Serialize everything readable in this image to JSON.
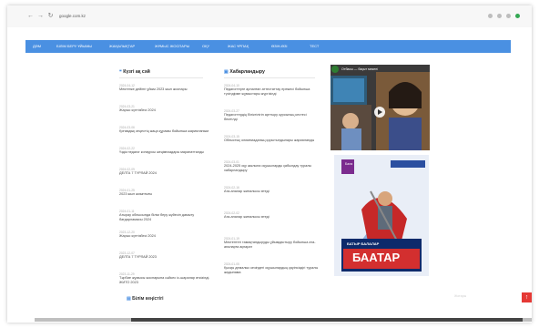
{
  "browser": {
    "url": "google.com.kz"
  },
  "menu": [
    "ДӘМ",
    "БІЛІМ БЕРУ ҰЙЫМЫ",
    "ЖАҢАЛЫҚТАР",
    "ЖҰМЫС ЖОСПАРЫ",
    "ОҚУ",
    "ЖАС ҰРПАҚ",
    "ӨЗІН-ӨЗІ",
    "ТЕСТ"
  ],
  "left_section": {
    "title": "Күзгі ақ сәй",
    "items": [
      {
        "date": "2024-04-12",
        "title": "Мектепке дейінгі ұйым 2023 жыл жоспары"
      },
      {
        "date": "2024-03-21",
        "title": "Жарыс күнтізбесі 2024"
      },
      {
        "date": "2024-03-06",
        "title": "Қоғамдық кеңестің жаңа құрамы бойынша жарияланым"
      },
      {
        "date": "2024-02-22",
        "title": "Үздік педагог конкурсы жеңімпаздары марапатталды"
      },
      {
        "date": "2024-02-09",
        "title": "ДЕЛТА 7 ТУРЛАЙ 2024"
      },
      {
        "date": "2024-01-25",
        "title": "2023 жыл жиынтығы"
      },
      {
        "date": "2024-01-11",
        "title": "Атырау облысында білім беру жүйесін дамыту бағдарламасы 2024"
      },
      {
        "date": "2023-12-20",
        "title": "Жарыс күнтізбесі 2024"
      },
      {
        "date": "2023-12-07",
        "title": "ДЕЛТА 7 ТУРЛАЙ 2023"
      },
      {
        "date": "2023-11-29",
        "title": "Тәрбие жұмысы жоспарына сәйкес іс-шаралар өткізілді. ЖИТО 2023"
      }
    ]
  },
  "middle_section": {
    "title": "Хабарландыру",
    "items": [
      {
        "date": "2024-04-10",
        "title": "Педагогтерге арналған аттестаттау ережесі бойынша түсіндірме жұмыстары жүргізілді"
      },
      {
        "date": "2024-03-27",
        "title": "Педагогтердің біліктілігін арттыру курсының кестесі бекітілді"
      },
      {
        "date": "2024-03-15",
        "title": "Облыстық олимпиаданың қорытындылары жарияланды"
      },
      {
        "date": "2024-03-01",
        "title": "2024-2025 оқу жылына оқушыларды қабылдау туралы хабарландыру"
      },
      {
        "date": "2024-02-16",
        "title": "Ата-аналар жиналысы өтеді"
      },
      {
        "date": "2024-02-02",
        "title": "Ата-аналар жиналысы өтеді"
      },
      {
        "date": "2024-01-19",
        "title": "Мектептегі тамақтандыруды ұйымдастыру бойынша ата-аналарға ақпарат"
      },
      {
        "date": "2024-01-05",
        "title": "Қысқы демалыс кезіндегі оқушылардың қауіпсіздігі туралы жадынама"
      }
    ]
  },
  "video": {
    "title": "Отбасы — бақыт мекені"
  },
  "poster": {
    "brand": "Бала",
    "caption": "БАТЫР БАЛАЛАР",
    "title": "БААТАР"
  },
  "bottom": {
    "title": "Білім кеңістігі"
  },
  "footer": {
    "faint": "Жоғары",
    "totop": "↑"
  },
  "colors": {
    "menu": "#4a90e2",
    "accent_red": "#e53935",
    "background": "#ffffff"
  }
}
